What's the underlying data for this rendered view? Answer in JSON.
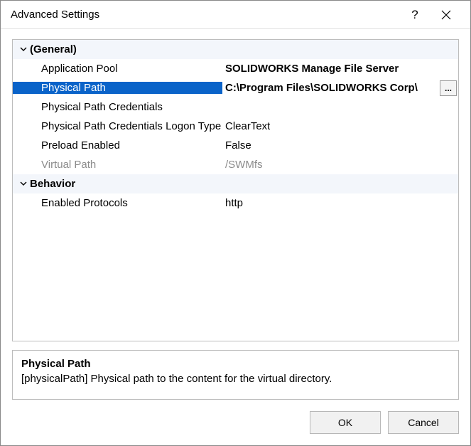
{
  "window": {
    "title": "Advanced Settings",
    "help_icon": "?",
    "close_icon": "✕"
  },
  "categories": [
    {
      "label": "(General)",
      "expanded": true,
      "rows": [
        {
          "label": "Application Pool",
          "value": "SOLIDWORKS Manage File Server",
          "bold": true,
          "selected": false,
          "readonly": false,
          "browse": false
        },
        {
          "label": "Physical Path",
          "value": "C:\\Program Files\\SOLIDWORKS Corp\\",
          "bold": true,
          "selected": true,
          "readonly": false,
          "browse": true
        },
        {
          "label": "Physical Path Credentials",
          "value": "",
          "bold": false,
          "selected": false,
          "readonly": false,
          "browse": false
        },
        {
          "label": "Physical Path Credentials Logon Type",
          "value": "ClearText",
          "bold": false,
          "selected": false,
          "readonly": false,
          "browse": false
        },
        {
          "label": "Preload Enabled",
          "value": "False",
          "bold": false,
          "selected": false,
          "readonly": false,
          "browse": false
        },
        {
          "label": "Virtual Path",
          "value": "/SWMfs",
          "bold": false,
          "selected": false,
          "readonly": true,
          "browse": false
        }
      ]
    },
    {
      "label": "Behavior",
      "expanded": true,
      "rows": [
        {
          "label": "Enabled Protocols",
          "value": "http",
          "bold": false,
          "selected": false,
          "readonly": false,
          "browse": false
        }
      ]
    }
  ],
  "help": {
    "title": "Physical Path",
    "description": "[physicalPath] Physical path to the content for the virtual directory."
  },
  "buttons": {
    "ok": "OK",
    "cancel": "Cancel"
  },
  "browse_label": "..."
}
